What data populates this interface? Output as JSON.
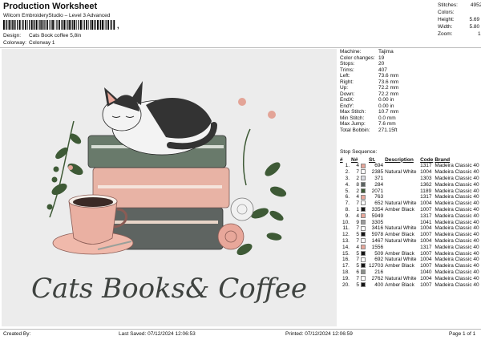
{
  "header": {
    "title": "Production Worksheet",
    "subtitle": "Wilcom EmbroideryStudio – Level 3 Advanced",
    "barcode_mark": ",",
    "design_label": "Design:",
    "design_value": "Cats Book coffee 5,8in",
    "colorway_label": "Colorway:",
    "colorway_value": "Colorway 1"
  },
  "stats": [
    {
      "k": "Stitches:",
      "v": "49529"
    },
    {
      "k": "Colors:",
      "v": "9"
    },
    {
      "k": "Height:",
      "v": "5.69 in"
    },
    {
      "k": "Width:",
      "v": "5.80 in"
    },
    {
      "k": "Zoom:",
      "v": "1:1"
    }
  ],
  "info": [
    {
      "k": "Machine:",
      "v": "Tajima"
    },
    {
      "k": "Color changes:",
      "v": "19"
    },
    {
      "k": "Stops:",
      "v": "20"
    },
    {
      "k": "Trims:",
      "v": "407"
    },
    {
      "k": "Left:",
      "v": "73.6 mm"
    },
    {
      "k": "Right:",
      "v": "73.6 mm"
    },
    {
      "k": "Up:",
      "v": "72.2 mm"
    },
    {
      "k": "Down:",
      "v": "72.2 mm"
    },
    {
      "k": "EndX:",
      "v": "0.00 in"
    },
    {
      "k": "EndY:",
      "v": "0.00 in"
    },
    {
      "k": "Max Stitch:",
      "v": "10.7 mm"
    },
    {
      "k": "Min Stitch:",
      "v": "0.0 mm"
    },
    {
      "k": "Max Jump:",
      "v": "7.6 mm"
    },
    {
      "k": "Total Bobbin:",
      "v": "271.15ft"
    }
  ],
  "sequence": {
    "title": "Stop Sequence:",
    "headers": [
      "#",
      "N#",
      "",
      "St.",
      "Description",
      "Code",
      "Brand"
    ],
    "rows": [
      {
        "n": "1.",
        "nn": "4",
        "color": "#e8a79a",
        "st": "694",
        "desc": "",
        "code": "1317",
        "brand": "Madeira Classic 40"
      },
      {
        "n": "2.",
        "nn": "7",
        "color": "#ffffff",
        "st": "2385",
        "desc": "Natural White",
        "code": "1004",
        "brand": "Madeira Classic 40"
      },
      {
        "n": "3.",
        "nn": "2",
        "color": "#d9dbe2",
        "st": "371",
        "desc": "",
        "code": "1303",
        "brand": "Madeira Classic 40"
      },
      {
        "n": "4.",
        "nn": "8",
        "color": "#5b6361",
        "st": "284",
        "desc": "",
        "code": "1362",
        "brand": "Madeira Classic 40"
      },
      {
        "n": "5.",
        "nn": "2",
        "color": "#3e5a36",
        "st": "2071",
        "desc": "",
        "code": "1189",
        "brand": "Madeira Classic 40"
      },
      {
        "n": "6.",
        "nn": "4",
        "color": "#e8a79a",
        "st": "763",
        "desc": "",
        "code": "1317",
        "brand": "Madeira Classic 40"
      },
      {
        "n": "7.",
        "nn": "7",
        "color": "#ffffff",
        "st": "652",
        "desc": "Natural White",
        "code": "1004",
        "brand": "Madeira Classic 40"
      },
      {
        "n": "8.",
        "nn": "1",
        "color": "#151515",
        "st": "3354",
        "desc": "Amber Black",
        "code": "1007",
        "brand": "Madeira Classic 40"
      },
      {
        "n": "9.",
        "nn": "4",
        "color": "#e8a79a",
        "st": "5949",
        "desc": "",
        "code": "1317",
        "brand": "Madeira Classic 40"
      },
      {
        "n": "10.",
        "nn": "9",
        "color": "#9b9b9b",
        "st": "3305",
        "desc": "",
        "code": "1041",
        "brand": "Madeira Classic 40"
      },
      {
        "n": "11.",
        "nn": "7",
        "color": "#ffffff",
        "st": "3416",
        "desc": "Natural White",
        "code": "1004",
        "brand": "Madeira Classic 40"
      },
      {
        "n": "12.",
        "nn": "5",
        "color": "#151515",
        "st": "5978",
        "desc": "Amber Black",
        "code": "1007",
        "brand": "Madeira Classic 40"
      },
      {
        "n": "13.",
        "nn": "7",
        "color": "#ffffff",
        "st": "1467",
        "desc": "Natural White",
        "code": "1004",
        "brand": "Madeira Classic 40"
      },
      {
        "n": "14.",
        "nn": "4",
        "color": "#e8a79a",
        "st": "1556",
        "desc": "",
        "code": "1317",
        "brand": "Madeira Classic 40"
      },
      {
        "n": "15.",
        "nn": "5",
        "color": "#151515",
        "st": "509",
        "desc": "Amber Black",
        "code": "1007",
        "brand": "Madeira Classic 40"
      },
      {
        "n": "16.",
        "nn": "7",
        "color": "#ffffff",
        "st": "692",
        "desc": "Natural White",
        "code": "1004",
        "brand": "Madeira Classic 40"
      },
      {
        "n": "17.",
        "nn": "5",
        "color": "#151515",
        "st": "12703",
        "desc": "Amber Black",
        "code": "1007",
        "brand": "Madeira Classic 40"
      },
      {
        "n": "18.",
        "nn": "6",
        "color": "#8b8f8a",
        "st": "216",
        "desc": "",
        "code": "1040",
        "brand": "Madeira Classic 40"
      },
      {
        "n": "19.",
        "nn": "7",
        "color": "#ffffff",
        "st": "2762",
        "desc": "Natural White",
        "code": "1004",
        "brand": "Madeira Classic 40"
      },
      {
        "n": "20.",
        "nn": "5",
        "color": "#151515",
        "st": "400",
        "desc": "Amber Black",
        "code": "1007",
        "brand": "Madeira Classic 40"
      }
    ]
  },
  "design_image": {
    "lettering": "Cats Books& Coffee"
  },
  "footer": {
    "created": "Created By:",
    "last_saved": "Last Saved: 07/12/2024 12:06:53",
    "printed": "Printed: 07/12/2024 12:06:59",
    "page": "Page 1 of 1"
  }
}
